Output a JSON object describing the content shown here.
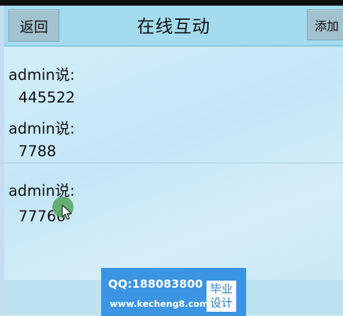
{
  "header": {
    "back_label": "返回",
    "title": "在线互动",
    "add_label": "添加"
  },
  "messages": [
    {
      "author": "admin说:",
      "text": "445522"
    },
    {
      "author": "admin说:",
      "text": "7788"
    },
    {
      "author": "admin说:",
      "text": "77766"
    }
  ],
  "watermark": {
    "qq": "QQ:188083800",
    "url": "www.kecheng8.com",
    "badge_line1": "毕业",
    "badge_line2": "设计"
  },
  "colors": {
    "header_bg": "#a4dbee",
    "button_bg": "#a2c2cf",
    "watermark_bg": "#3b95e2",
    "touch_indicator": "#5aa866"
  }
}
